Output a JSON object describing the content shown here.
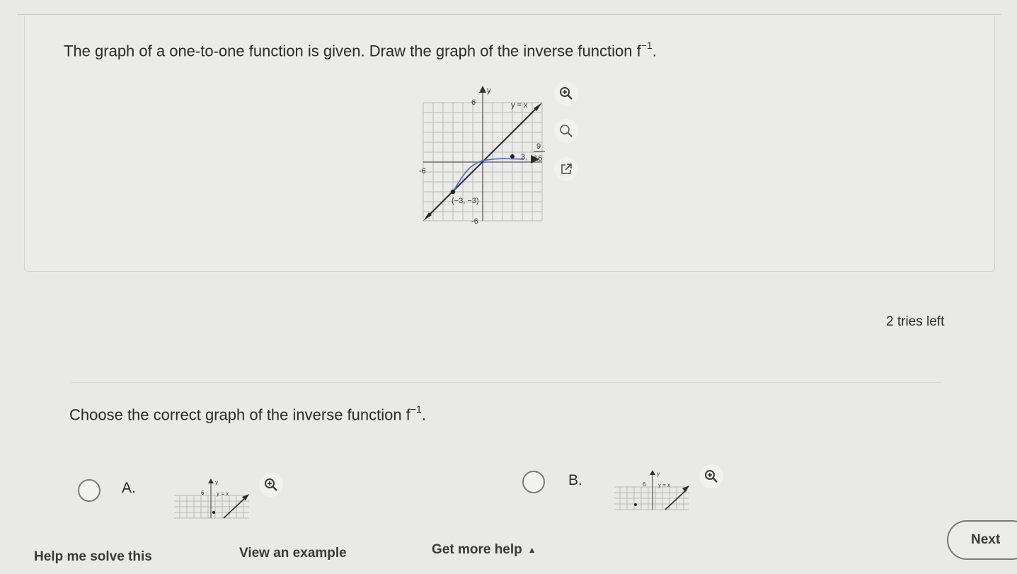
{
  "question": {
    "prompt": "The graph of a one-to-one function is given. Draw the graph of the inverse function",
    "inverse_symbol": "f",
    "inverse_sup": "−1",
    "period": "."
  },
  "graph": {
    "y_axis_label": "y",
    "tick_pos": "6",
    "tick_neg_x": "-6",
    "tick_neg_y": "-6",
    "line_label": "y = x",
    "point_a_label": "(−3, −3)",
    "point_b_label_x": "3,",
    "point_b_num": "9",
    "point_b_den": "16",
    "zoom_in_icon": "zoom-in-icon",
    "zoom_out_icon": "zoom-out-icon",
    "expand_icon": "external-link-icon"
  },
  "status": {
    "tries": "2 tries left"
  },
  "choice_prompt": {
    "text": "Choose the correct graph of the inverse function",
    "inverse_symbol": "f",
    "inverse_sup": "−1",
    "period": "."
  },
  "options": [
    {
      "letter": "A.",
      "tick": "6",
      "axis": "y",
      "line_label": "y = x"
    },
    {
      "letter": "B.",
      "tick": "6",
      "axis": "y",
      "line_label": "y = x"
    }
  ],
  "footer": {
    "help": "Help me solve this",
    "example": "View an example",
    "more_help": "Get more help",
    "next": "Next"
  },
  "colors": {
    "curve": "#5a6fd0",
    "line": "#2a2a2a",
    "grid": "#b9b9b9"
  }
}
